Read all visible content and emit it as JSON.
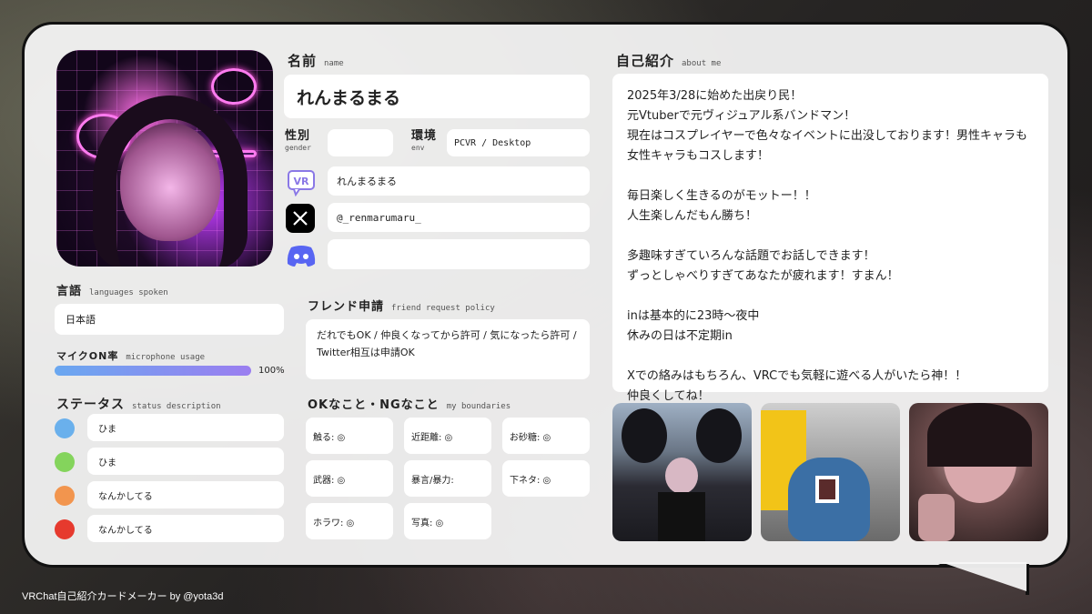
{
  "profile": {
    "name_label": "名前",
    "name_label_sub": "name",
    "name_value": "れんまるまる",
    "gender_label": "性別",
    "gender_label_sub": "gender",
    "gender_value": "",
    "env_label": "環境",
    "env_label_sub": "env",
    "env_value": "PCVR / Desktop",
    "vrchat_value": "れんまるまる",
    "x_value": "@_renmarumaru_",
    "discord_value": ""
  },
  "languages": {
    "label": "言語",
    "label_sub": "languages spoken",
    "value": "日本語"
  },
  "microphone": {
    "label": "マイクON率",
    "label_sub": "microphone usage",
    "percent_text": "100%",
    "level": 1.0
  },
  "status": {
    "label": "ステータス",
    "label_sub": "status description",
    "items": [
      {
        "color": "#6ab0ec",
        "text": "ひま"
      },
      {
        "color": "#84d45c",
        "text": "ひま"
      },
      {
        "color": "#f2954e",
        "text": "なんかしてる"
      },
      {
        "color": "#e63a2e",
        "text": "なんかしてる"
      }
    ]
  },
  "friend_request": {
    "label": "フレンド申請",
    "label_sub": "friend request policy",
    "text": "だれでもOK / 仲良くなってから許可 / 気になったら許可 / Twitter相互は申請OK"
  },
  "boundaries": {
    "label": "OKなこと・NGなこと",
    "label_sub": "my boundaries",
    "items": [
      "触る: ◎",
      "近距離: ◎",
      "お砂糖: ◎",
      "武器: ◎",
      "暴言/暴力:",
      "下ネタ: ◎",
      "ホラワ: ◎",
      "写真: ◎"
    ]
  },
  "about": {
    "label": "自己紹介",
    "label_sub": "about me",
    "text": "2025年3/28に始めた出戻り民！\n元Vtuberで元ヴィジュアル系バンドマン！\n現在はコスプレイヤーで色々なイベントに出没しております！男性キャラも女性キャラもコスします！\n\n毎日楽しく生きるのがモットー！！\n人生楽しんだもん勝ち！\n\n多趣味すぎていろんな話題でお話しできます！\nずっとしゃべりすぎてあなたが疲れます！すまん！\n\ninは基本的に23時～夜中\n休みの日は不定期in\n\nXでの絡みはもちろん、VRCでも気軽に遊べる人がいたら神！！\n仲良くしてね！"
  },
  "footer": {
    "text": "VRChat自己紹介カードメーカー by @yota3d"
  },
  "icons": {
    "vrchat": "vrchat-icon",
    "x": "x-logo-icon",
    "discord": "discord-icon"
  },
  "colors": {
    "vrchat_purple": "#8a78e6",
    "discord_blue": "#5865f2",
    "x_black": "#000000"
  }
}
